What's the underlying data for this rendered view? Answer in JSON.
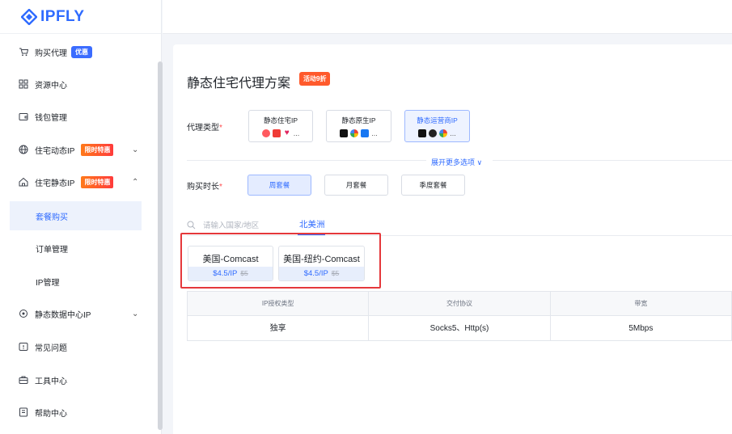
{
  "brand": {
    "name": "IPFLY"
  },
  "sidebar": {
    "items": [
      {
        "label": "购买代理",
        "badge": "优惠"
      },
      {
        "label": "资源中心"
      },
      {
        "label": "钱包管理"
      },
      {
        "label": "住宅动态IP",
        "badge": "限时特惠"
      },
      {
        "label": "住宅静态IP",
        "badge": "限时特惠"
      },
      {
        "label": "静态数据中心IP"
      },
      {
        "label": "常见问题"
      },
      {
        "label": "工具中心"
      },
      {
        "label": "帮助中心"
      }
    ],
    "sub_items": [
      {
        "label": "套餐购买"
      },
      {
        "label": "订单管理"
      },
      {
        "label": "IP管理"
      }
    ]
  },
  "main": {
    "title": "静态住宅代理方案",
    "promo": "活动9折",
    "proxy_type_label": "代理类型",
    "proxy_types": [
      {
        "label": "静态住宅IP",
        "more": "..."
      },
      {
        "label": "静态原生IP",
        "more": "..."
      },
      {
        "label": "静态运营商IP",
        "more": "..."
      }
    ],
    "expand_label": "展开更多选项 ∨",
    "duration_label": "购买时长",
    "durations": [
      "周套餐",
      "月套餐",
      "季度套餐"
    ],
    "search_placeholder": "请输入国家/地区",
    "region_tab": "北美洲",
    "plans": [
      {
        "name": "美国-Comcast",
        "price": "$4.5/IP",
        "original": "$5"
      },
      {
        "name": "美国-纽约-Comcast",
        "price": "$4.5/IP",
        "original": "$5"
      }
    ],
    "spec_headers": [
      "IP授权类型",
      "交付协议",
      "带宽"
    ],
    "spec_values": [
      "独享",
      "Socks5、Http(s)",
      "5Mbps"
    ]
  },
  "colors": {
    "accent": "#2f6bff",
    "highlight": "#e5383b",
    "promo": "#ff5a2c"
  }
}
